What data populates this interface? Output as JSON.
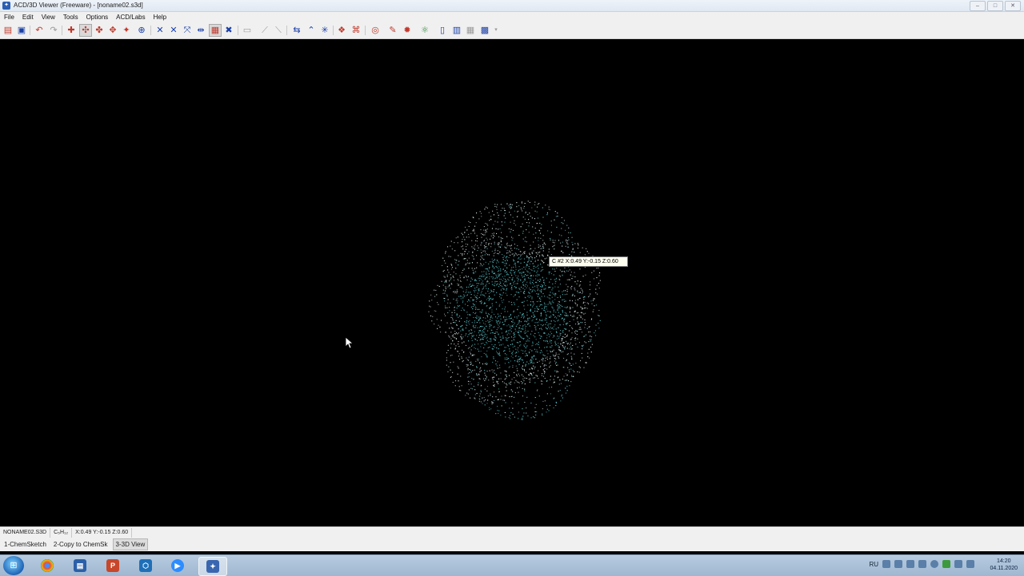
{
  "window": {
    "title": "ACD/3D Viewer (Freeware) - [noname02.s3d]",
    "controls": [
      "–",
      "□",
      "✕"
    ]
  },
  "menu": [
    "File",
    "Edit",
    "View",
    "Tools",
    "Options",
    "ACD/Labs",
    "Help"
  ],
  "tooltip": {
    "text": "C #2 X:0.49 Y:-0.15 Z:0.60"
  },
  "status": {
    "filename": "NONAME02.S3D",
    "formula": "C₅H₁₂",
    "coords": "X:0.49 Y:-0.15 Z:0.60"
  },
  "tabs": [
    "1-ChemSketch",
    "2-Copy to ChemSk",
    "3-3D View"
  ],
  "tray": {
    "lang": "RU",
    "time": "14:20",
    "date": "04.11.2020"
  },
  "colors": {
    "molecule_dots_primary": "#5fd0d6",
    "molecule_dots_secondary": "#e8f4f4",
    "viewport_bg": "#000000"
  }
}
